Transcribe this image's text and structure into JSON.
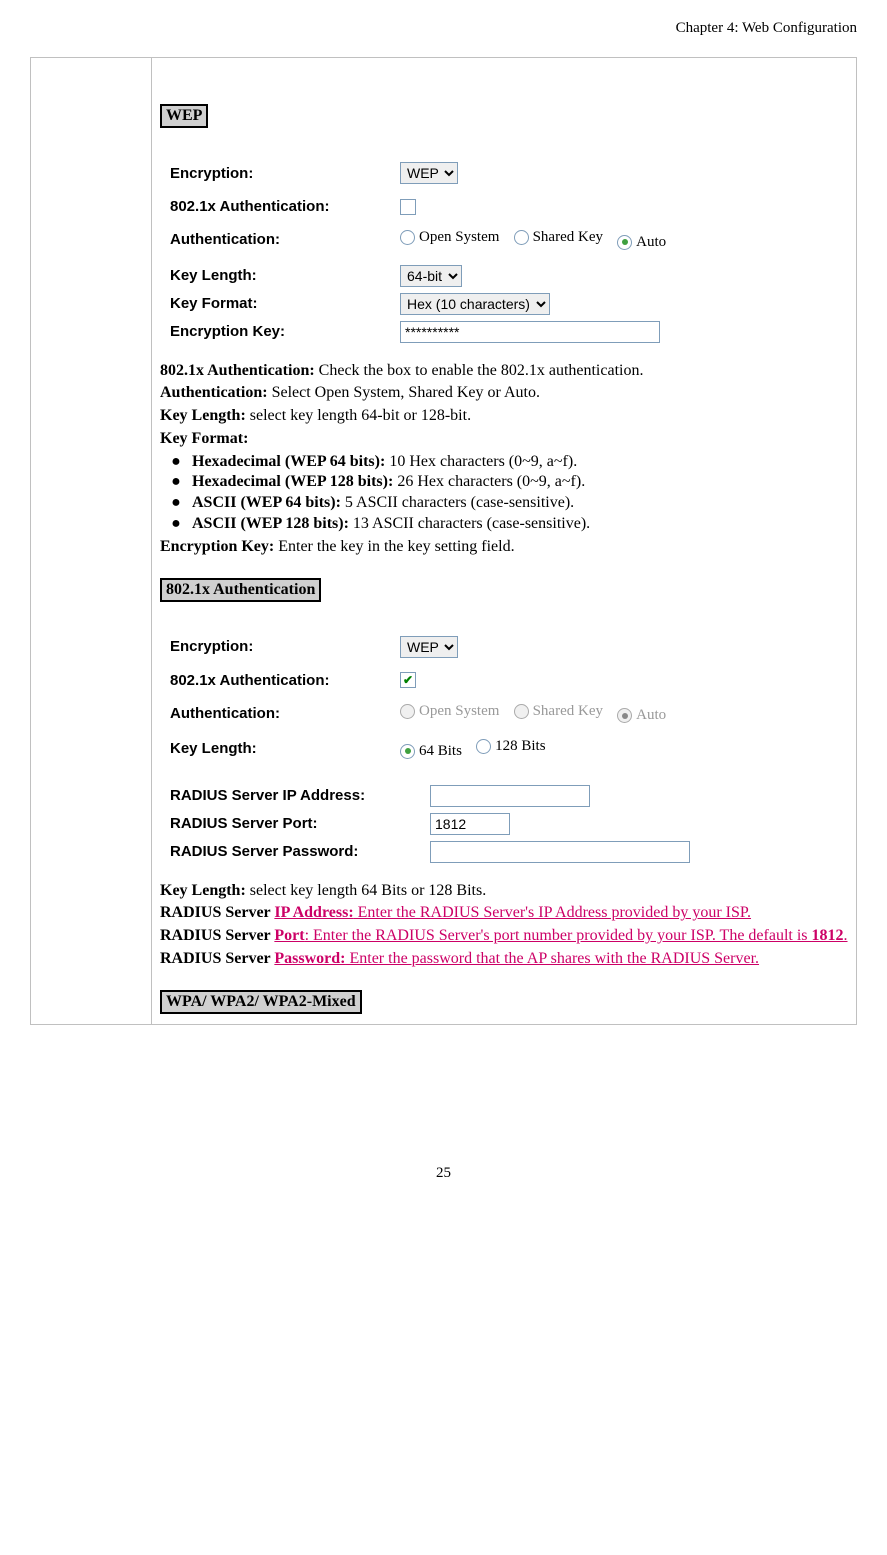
{
  "chapter": "Chapter 4: Web Configuration",
  "page_number": "25",
  "wep": {
    "title": "WEP",
    "labels": {
      "encryption": "Encryption:",
      "dot1x": "802.1x Authentication:",
      "auth": "Authentication:",
      "keylen": "Key Length:",
      "keyfmt": "Key Format:",
      "enckey": "Encryption Key:"
    },
    "encryption_value": "WEP",
    "auth_options": {
      "open": "Open System",
      "shared": "Shared Key",
      "auto": "Auto"
    },
    "keylen_value": "64-bit",
    "keyfmt_value": "Hex (10 characters)",
    "enckey_value": "**********",
    "desc": {
      "dot1x_bold": "802.1x Authentication:",
      "dot1x_text": " Check the box to enable the 802.1x authentication.",
      "auth_bold": "Authentication:",
      "auth_text": " Select Open System, Shared Key or Auto.",
      "keylen_bold": "Key Length:",
      "keylen_text": " select key length 64-bit or 128-bit.",
      "keyfmt_bold": "Key Format:",
      "b1_bold": "Hexadecimal (WEP 64 bits):",
      "b1_text": " 10 Hex characters (0~9, a~f).",
      "b2_bold": "Hexadecimal (WEP 128 bits):",
      "b2_text": " 26 Hex characters (0~9, a~f).",
      "b3_bold": "ASCII (WEP 64 bits):",
      "b3_text": " 5 ASCII characters (case-sensitive).",
      "b4_bold": "ASCII (WEP 128 bits):",
      "b4_text": " 13 ASCII characters (case-sensitive).",
      "enckey_bold": "Encryption Key:",
      "enckey_text": " Enter the key in the key setting field."
    }
  },
  "dot1x_section": {
    "title": "802.1x Authentication",
    "labels": {
      "encryption": "Encryption:",
      "dot1x": "802.1x Authentication:",
      "auth": "Authentication:",
      "keylen": "Key Length:",
      "radius_ip": "RADIUS Server IP Address:",
      "radius_port": "RADIUS Server Port:",
      "radius_pw": "RADIUS Server Password:"
    },
    "encryption_value": "WEP",
    "auth_options": {
      "open": "Open System",
      "shared": "Shared Key",
      "auto": "Auto"
    },
    "keylen_options": {
      "k64": "64 Bits",
      "k128": "128 Bits"
    },
    "radius_port_value": "1812",
    "desc": {
      "keylen_bold": "Key Length:",
      "keylen_text": " select key length 64 Bits or 128 Bits.",
      "ip_bold": "RADIUS Server ",
      "ip_link_bold": "IP Address:",
      "ip_link_rest": " Enter the RADIUS Server's IP Address provided by your ISP.",
      "port_bold": "RADIUS Server ",
      "port_link_bold": "Port",
      "port_link_rest1": ": Enter the RADIUS Server's port number provided by your ISP. The default is ",
      "port_link_rest2": "1812",
      "port_link_rest3": ".",
      "pw_bold": "RADIUS Server ",
      "pw_link_bold": "Password:",
      "pw_link_rest": " Enter the password that the AP shares with the RADIUS Server."
    }
  },
  "wpa_title": "WPA/ WPA2/ WPA2-Mixed"
}
